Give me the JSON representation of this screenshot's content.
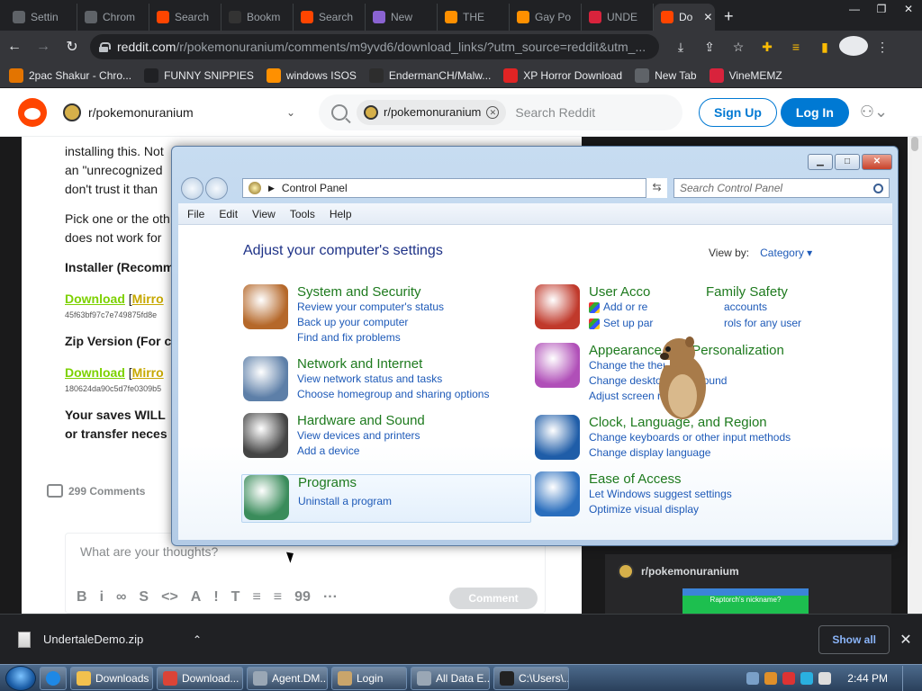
{
  "browser": {
    "tabs": [
      {
        "label": "Settin",
        "fav_color": "#5f6368"
      },
      {
        "label": "Chrom",
        "fav_color": "#5f6368"
      },
      {
        "label": "Search",
        "fav_color": "#ff4500"
      },
      {
        "label": "Bookm",
        "fav_color": "#333333"
      },
      {
        "label": "Search",
        "fav_color": "#ff4500"
      },
      {
        "label": "New",
        "fav_color": "#8a63d2"
      },
      {
        "label": "THE",
        "fav_color": "#ff9000"
      },
      {
        "label": "Gay Po",
        "fav_color": "#ff9000"
      },
      {
        "label": "UNDE",
        "fav_color": "#d8233c"
      },
      {
        "label": "Do",
        "fav_color": "#ff4500"
      }
    ],
    "active_tab_index": 9,
    "new_tab": "+",
    "url_host": "reddit.com",
    "url_path": "/r/pokemonuranium/comments/m9yvd6/download_links/?utm_source=reddit&utm_...",
    "bookmarks": [
      {
        "label": "2pac Shakur - Chro...",
        "icon": "chrome-store",
        "color": "#e37400"
      },
      {
        "label": "FUNNY SNIPPIES",
        "icon": "H",
        "color": "#202124"
      },
      {
        "label": "windows ISOS",
        "icon": "PH",
        "color": "#ff9000"
      },
      {
        "label": "EndermanCH/Malw...",
        "icon": "YP",
        "color": "#2d2d2d"
      },
      {
        "label": "XP Horror Download",
        "icon": "X",
        "color": "#e02424"
      },
      {
        "label": "New Tab",
        "icon": "globe",
        "color": "#5f6368"
      },
      {
        "label": "VineMEMZ",
        "icon": "R",
        "color": "#d8233c"
      }
    ]
  },
  "reddit": {
    "subreddit": "r/pokemonuranium",
    "search_chip": "r/pokemonuranium",
    "search_placeholder": "Search Reddit",
    "signup": "Sign Up",
    "login": "Log In",
    "post": {
      "line1": "installing this. Not",
      "line2": "an \"unrecognized",
      "line3": "don't trust it than",
      "para2_a": "Pick one or the oth",
      "para2_b": "does not work for",
      "installer_title": "Installer (Recomm",
      "download": "Download",
      "mirror": "Mirro",
      "hash1": "45f63bf97c7e749875fd8e",
      "zip_title": "Zip Version (For c",
      "hash2": "180624da90c5d7fe0309b5",
      "saves_a": "Your saves WILL",
      "saves_b": "or transfer neces",
      "comments": "299 Comments",
      "comment_placeholder": "What are your thoughts?",
      "comment_btn": "Comment",
      "toolbar": [
        "B",
        "i",
        "∞",
        "S",
        "<>",
        "A",
        "!",
        "T",
        "≡",
        "≡",
        "99",
        "···"
      ]
    },
    "sidebar_sub": "r/pokemonuranium",
    "sidebar_banner": "Raptorch's nickname?"
  },
  "control_panel": {
    "address": "Control Panel",
    "search_placeholder": "Search Control Panel",
    "menu": [
      "File",
      "Edit",
      "View",
      "Tools",
      "Help"
    ],
    "heading": "Adjust your computer's settings",
    "view_by_label": "View by:",
    "view_by_value": "Category ▾",
    "categories": [
      {
        "title": "System and Security",
        "links": [
          "Review your computer's status",
          "Back up your computer",
          "Find and fix problems"
        ],
        "icon_color": "#b5682a"
      },
      {
        "title": "Network and Internet",
        "links": [
          "View network status and tasks",
          "Choose homegroup and sharing options"
        ],
        "icon_color": "#5d7fa8"
      },
      {
        "title": "Hardware and Sound",
        "links": [
          "View devices and printers",
          "Add a device"
        ],
        "icon_color": "#444444"
      },
      {
        "title": "Programs",
        "links": [
          "Uninstall a program"
        ],
        "icon_color": "#3a8c5b"
      },
      {
        "title": "User Acco",
        "title_b": "Family Safety",
        "links": [
          "Add or re",
          "accounts",
          "Set up par",
          "rols for any user"
        ],
        "icon_color": "#c0392b"
      },
      {
        "title": "Appearance and Personalization",
        "links": [
          "Change the theme",
          "Change desktop background",
          "Adjust screen resolution"
        ],
        "icon_color": "#b04fb8"
      },
      {
        "title": "Clock, Language, and Region",
        "links": [
          "Change keyboards or other input methods",
          "Change display language"
        ],
        "icon_color": "#1f5da8"
      },
      {
        "title": "Ease of Access",
        "links": [
          "Let Windows suggest settings",
          "Optimize visual display"
        ],
        "icon_color": "#2a6ebd"
      }
    ]
  },
  "download_shelf": {
    "file": "UndertaleDemo.zip",
    "show_all": "Show all"
  },
  "taskbar": {
    "items": [
      {
        "label": "Downloads",
        "color": "#f2c14e"
      },
      {
        "label": "Download...",
        "color": "#db4437"
      },
      {
        "label": "Agent.DM...",
        "color": "#9aa7b5"
      },
      {
        "label": "Login",
        "color": "#c9a56b"
      },
      {
        "label": "All Data E...",
        "color": "#9aa7b5"
      },
      {
        "label": "C:\\Users\\...",
        "color": "#222222"
      }
    ],
    "clock": "2:44 PM"
  }
}
